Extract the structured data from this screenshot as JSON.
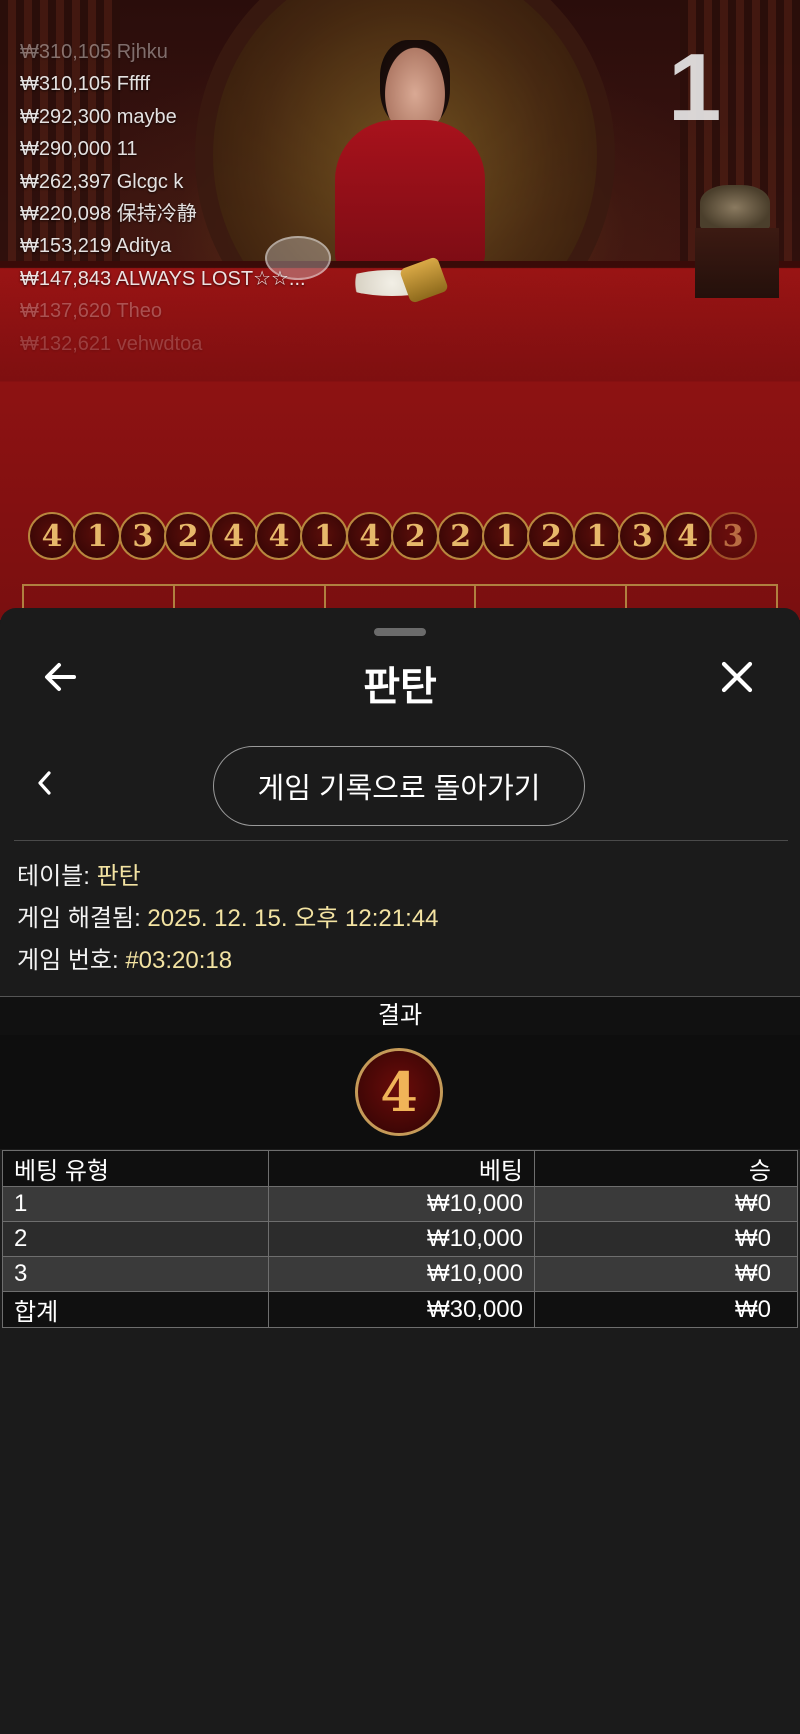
{
  "winners": [
    "₩310,105 Rjhku",
    "₩310,105 Fffff",
    "₩292,300 maybe",
    "₩290,000 11",
    "₩262,397 Glcgc k",
    "₩220,098 保持冷静",
    "₩153,219 Aditya",
    "₩147,843 ALWAYS LOST☆☆...",
    "₩137,620 Theo",
    "₩132,621 vehwdtoa"
  ],
  "round_counter": "1",
  "history": [
    "4",
    "1",
    "3",
    "2",
    "4",
    "4",
    "1",
    "4",
    "2",
    "2",
    "1",
    "2",
    "1",
    "3",
    "4",
    "3"
  ],
  "sheet": {
    "title": "판탄",
    "back_to_history_label": "게임 기록으로 돌아가기",
    "icons": {
      "back": "arrow-left-icon",
      "close": "close-icon",
      "prev": "chevron-left-icon"
    }
  },
  "details": {
    "table_label": "테이블:",
    "table_value": "판탄",
    "resolved_label": "게임 해결됨:",
    "resolved_value": "2025. 12. 15. 오후 12:21:44",
    "game_no_label": "게임 번호:",
    "game_no_value": "#03:20:18"
  },
  "result": {
    "header": "결과",
    "value": "4"
  },
  "bets_table": {
    "headers": [
      "베팅 유형",
      "베팅",
      "승"
    ],
    "rows": [
      {
        "type": "1",
        "bet": "₩10,000",
        "win": "₩0"
      },
      {
        "type": "2",
        "bet": "₩10,000",
        "win": "₩0"
      },
      {
        "type": "3",
        "bet": "₩10,000",
        "win": "₩0"
      }
    ],
    "total": {
      "type": "합계",
      "bet": "₩30,000",
      "win": "₩0"
    }
  },
  "colors": {
    "accent_value": "#f3e3a2",
    "ball_gold": "#e7b86a",
    "sheet_bg": "#1b1b1b"
  }
}
